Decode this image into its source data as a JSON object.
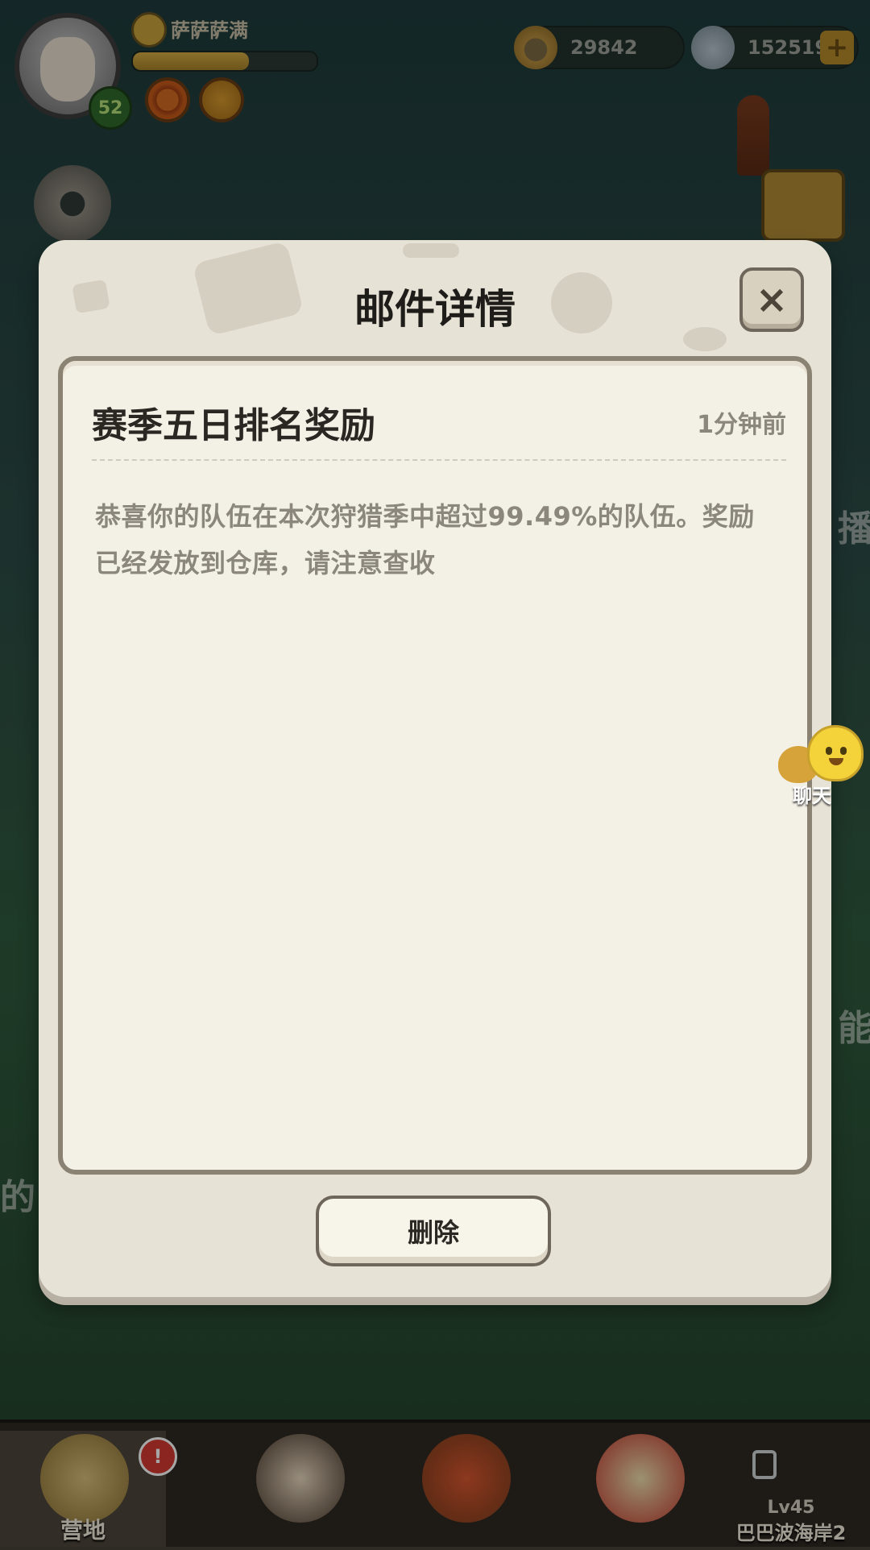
{
  "player": {
    "name": "萨萨萨满",
    "level": "52",
    "xp_progress": 0.63
  },
  "currencies": [
    {
      "icon": "coin-icon",
      "value": "29842"
    },
    {
      "icon": "gem-icon",
      "value": "152519",
      "add_label": "+"
    }
  ],
  "chat": {
    "label": "聊天"
  },
  "side_texts": {
    "right_top": "播",
    "right_mid": "能",
    "left_low": "的"
  },
  "mail": {
    "title": "邮件详情",
    "close_label": "×",
    "subject": "赛季五日排名奖励",
    "time": "1分钟前",
    "body": "恭喜你的队伍在本次狩猎季中超过99.49%的队伍。奖励已经发放到仓库，请注意查收",
    "delete_label": "删除"
  },
  "bottom_nav": {
    "items": [
      {
        "label": "营地",
        "active": true,
        "has_alert": true
      },
      {
        "label": ""
      },
      {
        "label": ""
      },
      {
        "label": ""
      },
      {
        "label": "巴巴波海岸2",
        "sublabel": "Lv45",
        "locked": true
      }
    ]
  },
  "colors": {
    "modal_bg": "#e7e2d6",
    "panel_bg": "#f3f0e6",
    "accent_gold": "#b48a2b",
    "alert_red": "#d63a32"
  }
}
